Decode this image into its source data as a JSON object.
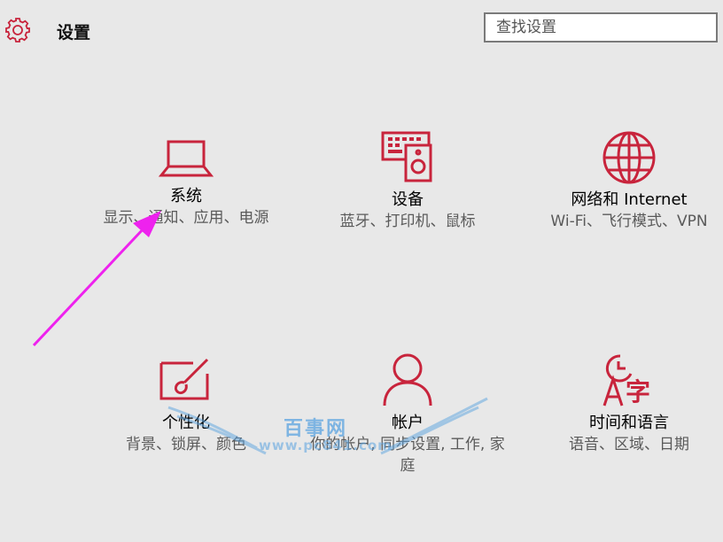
{
  "header": {
    "icon": "gear-icon",
    "title": "设置",
    "search_placeholder": "查找设置"
  },
  "tiles": [
    {
      "id": "system",
      "icon": "laptop-icon",
      "name": "系统",
      "desc": "显示、通知、应用、电源"
    },
    {
      "id": "devices",
      "icon": "devices-icon",
      "name": "设备",
      "desc": "蓝牙、打印机、鼠标"
    },
    {
      "id": "network",
      "icon": "globe-icon",
      "name": "网络和 Internet",
      "desc": "Wi-Fi、飞行模式、VPN"
    },
    {
      "id": "personalization",
      "icon": "paint-brush-icon",
      "name": "个性化",
      "desc": "背景、锁屏、颜色"
    },
    {
      "id": "accounts",
      "icon": "person-icon",
      "name": "帐户",
      "desc": "你的帐户, 同步设置, 工作, 家庭"
    },
    {
      "id": "time-language",
      "icon": "clock-language-icon",
      "name": "时间和语言",
      "desc": "语音、区域、日期"
    }
  ],
  "watermark": {
    "text": "百事网",
    "url": "www.pc841.com"
  },
  "colors": {
    "accent": "#c8243c",
    "background": "#e8e8e8",
    "arrow": "#ee22ee"
  }
}
